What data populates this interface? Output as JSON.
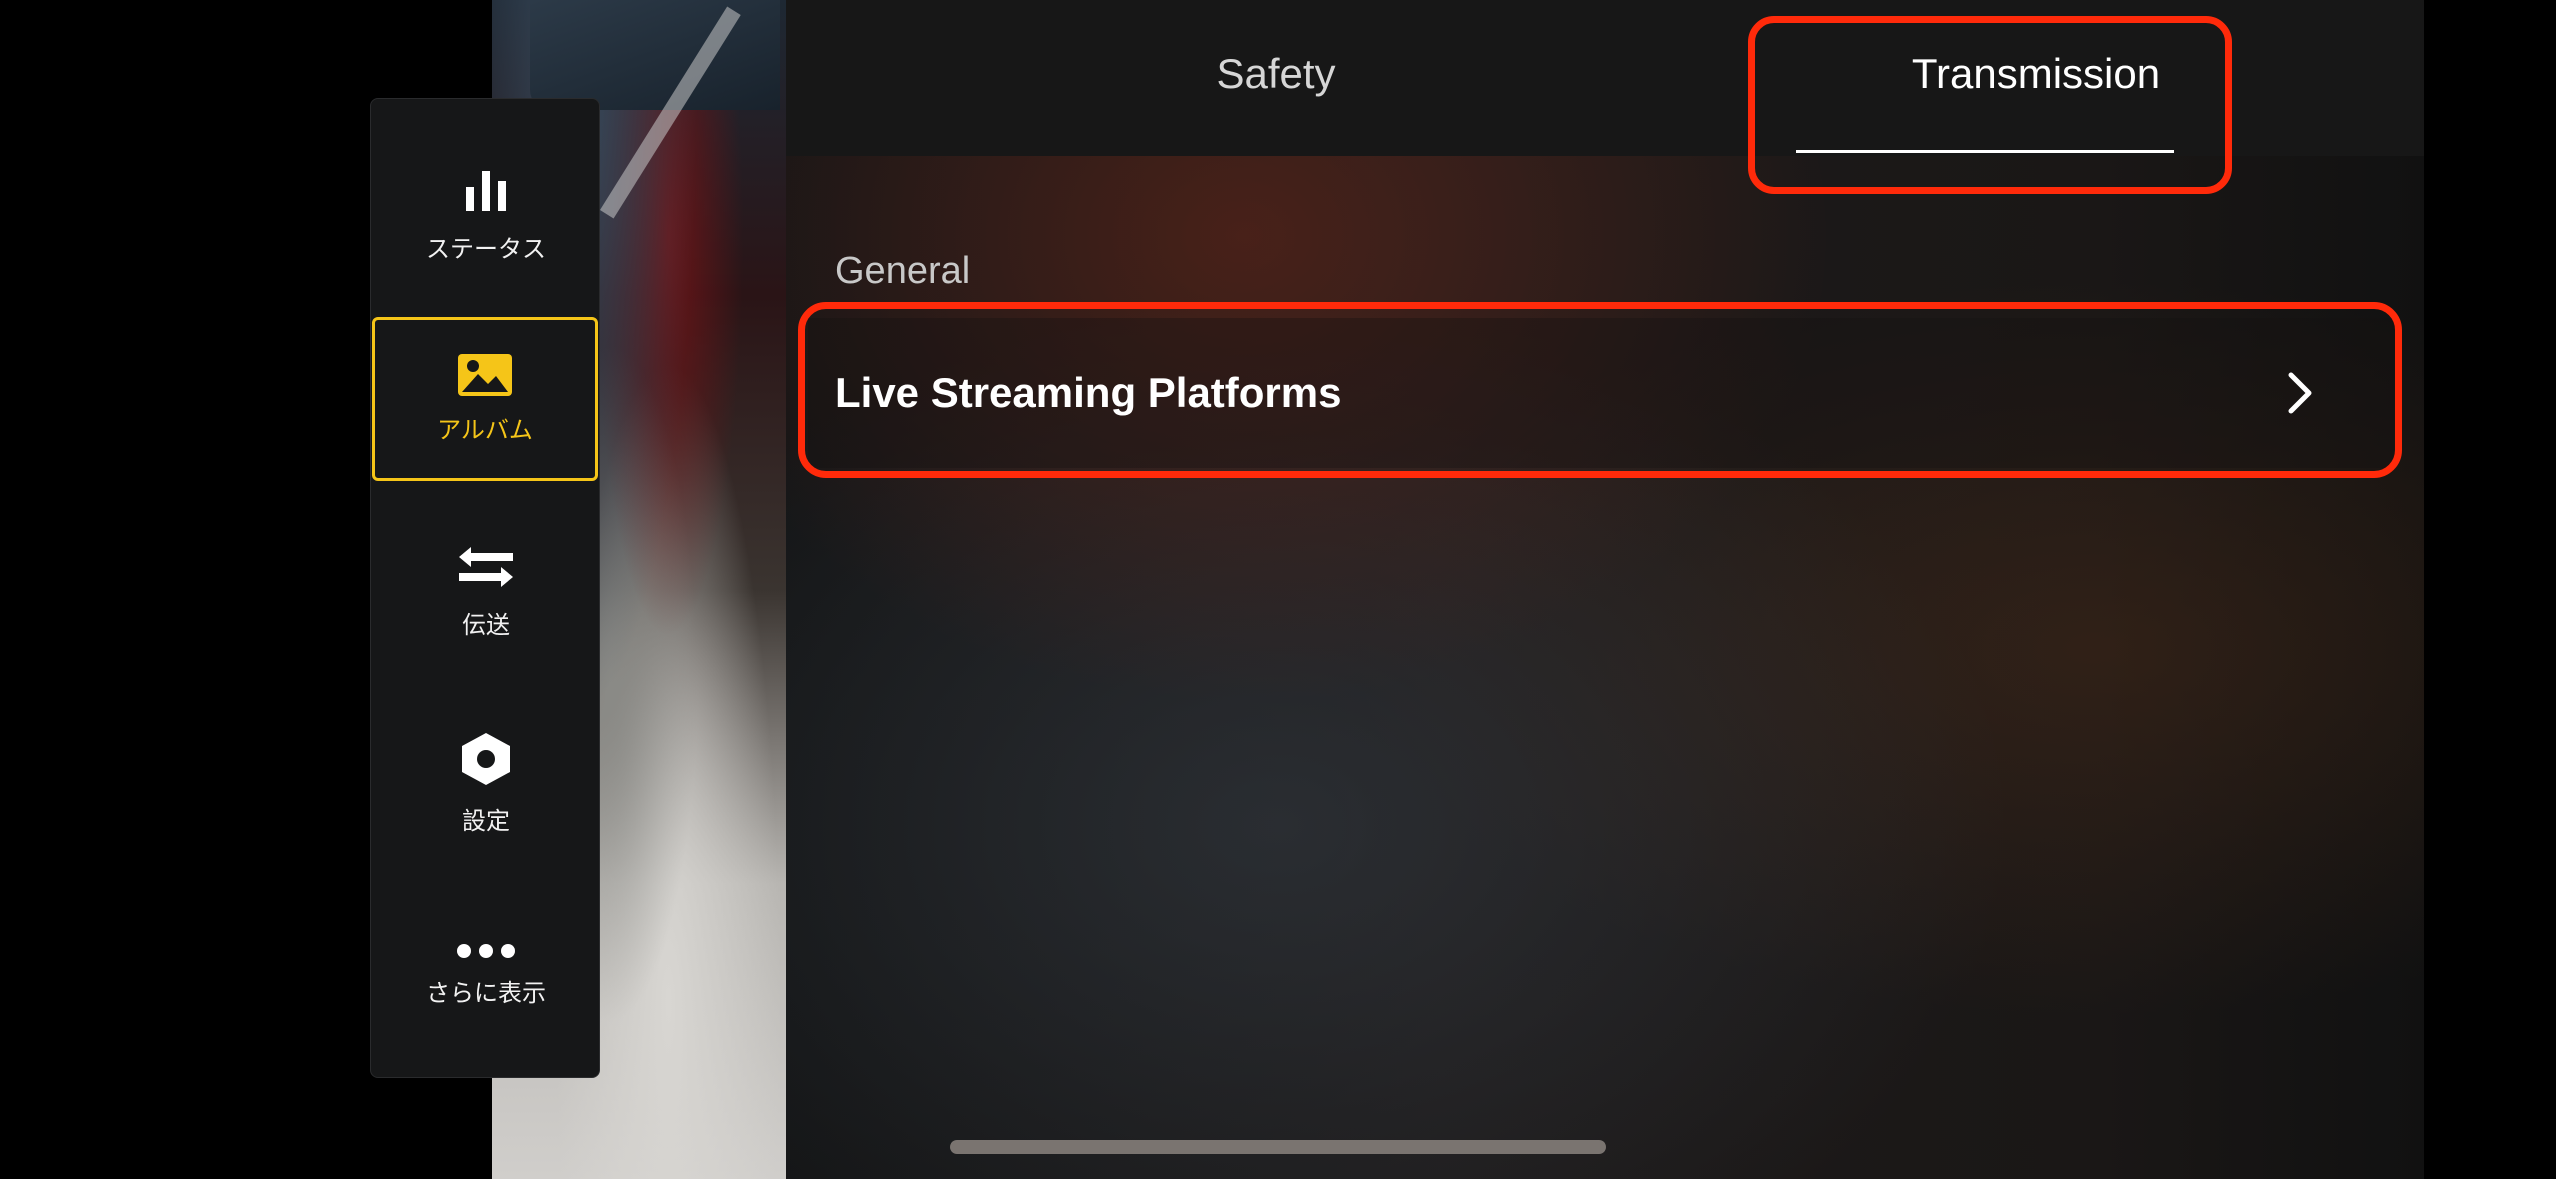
{
  "side_menu": {
    "items": [
      {
        "label": "ステータス",
        "icon": "bar-chart-icon"
      },
      {
        "label": "アルバム",
        "icon": "image-icon",
        "active": true
      },
      {
        "label": "伝送",
        "icon": "transfer-arrows-icon"
      },
      {
        "label": "設定",
        "icon": "hexagon-settings-icon"
      },
      {
        "label": "さらに表示",
        "icon": "more-dots-icon"
      }
    ]
  },
  "tabs": [
    {
      "label": "Safety"
    },
    {
      "label": "Transmission",
      "selected": true
    }
  ],
  "section": {
    "title": "General",
    "items": [
      {
        "label": "Live Streaming Platforms",
        "icon": "chevron-right-icon"
      }
    ]
  },
  "colors": {
    "accent": "#f5c518",
    "highlight": "#ff2a0a",
    "panel": "#171717"
  }
}
